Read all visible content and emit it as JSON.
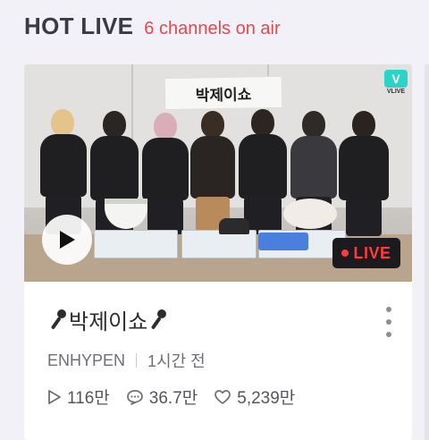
{
  "header": {
    "title": "HOT LIVE",
    "subtitle": "6 channels on air"
  },
  "card": {
    "thumbnail": {
      "sign_text": "박제이쇼",
      "channel_logo": {
        "icon": "vlive-logo-icon",
        "label": "VLIVE",
        "color": "#2bd4c6"
      },
      "play_icon": "play-icon",
      "live_badge": {
        "label": "LIVE",
        "dot_color": "#ff3b3b"
      }
    },
    "title": "박제이쇼",
    "title_icon": "microphone-icon",
    "channel": "ENHYPEN",
    "time": "1시간 전",
    "stats": {
      "views": "116만",
      "comments": "36.7만",
      "likes": "5,239만"
    },
    "more_icon": "more-vertical-icon"
  },
  "colors": {
    "accent": "#e5484d",
    "title": "#3a3a46",
    "background": "#f2f1f7"
  }
}
